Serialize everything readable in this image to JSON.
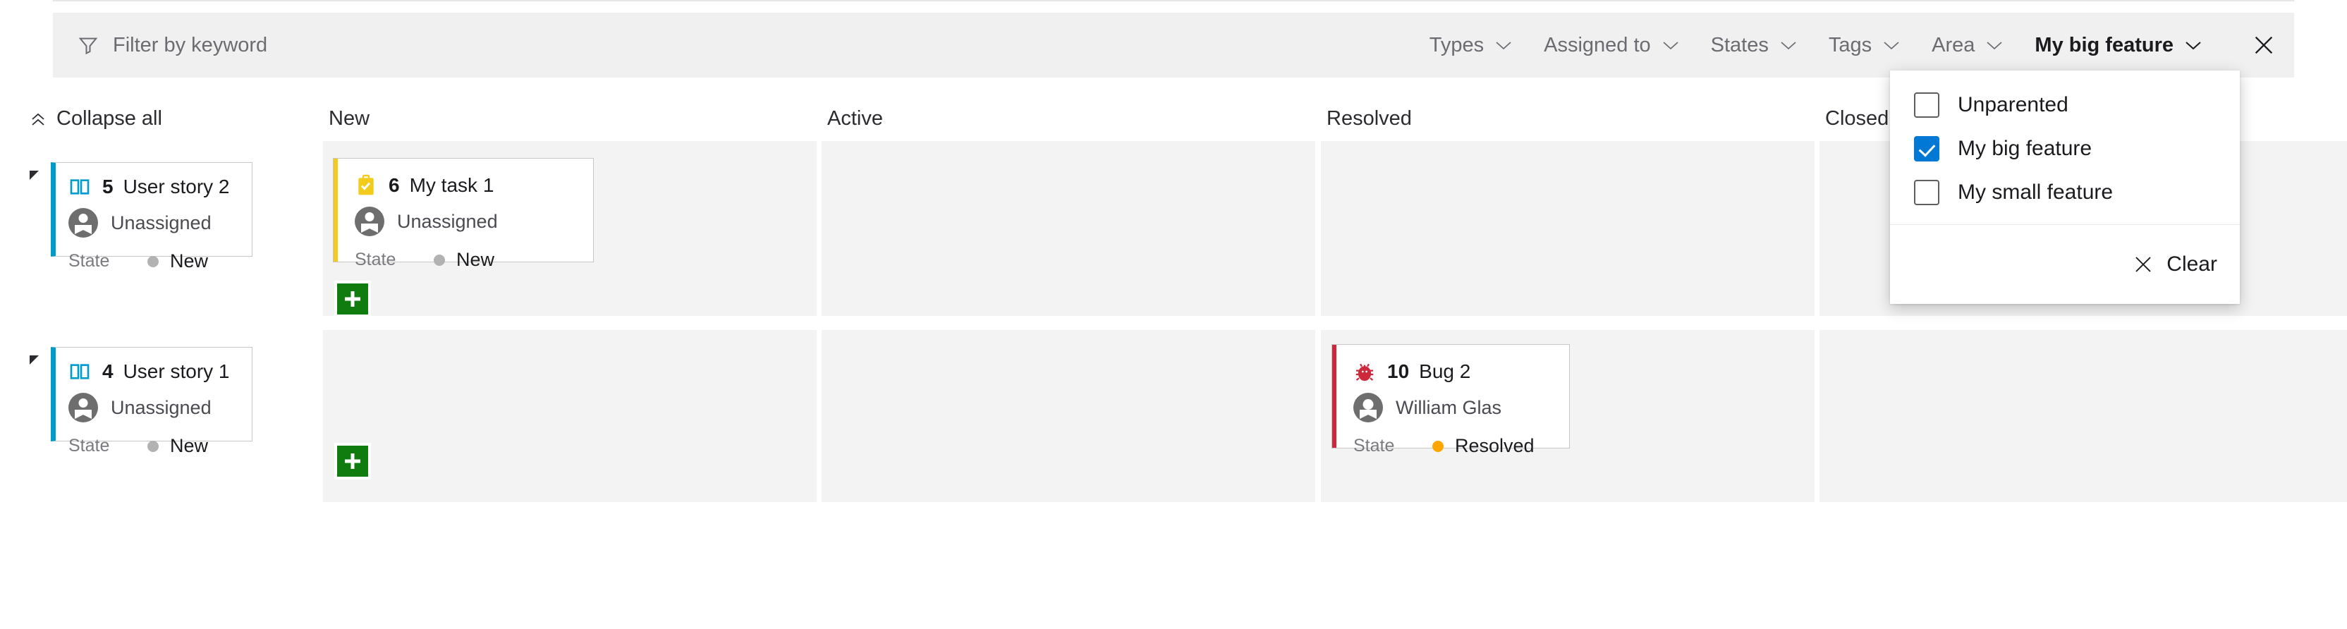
{
  "filter_bar": {
    "funnel_icon": "funnel-icon",
    "keyword": {
      "value": "",
      "placeholder": "Filter by keyword"
    },
    "pivots": [
      {
        "label": "Types",
        "active": false
      },
      {
        "label": "Assigned to",
        "active": false
      },
      {
        "label": "States",
        "active": false
      },
      {
        "label": "Tags",
        "active": false
      },
      {
        "label": "Area",
        "active": false
      },
      {
        "label": "My big feature",
        "active": true
      }
    ],
    "close_icon": "close-icon"
  },
  "dropdown": {
    "open": true,
    "options": [
      {
        "label": "Unparented",
        "checked": false
      },
      {
        "label": "My big feature",
        "checked": true
      },
      {
        "label": "My small feature",
        "checked": false
      }
    ],
    "clear": {
      "label": "Clear",
      "icon": "close-icon"
    }
  },
  "board": {
    "collapse_all": {
      "label": "Collapse all",
      "icon": "double-chevron-up-icon"
    },
    "columns": [
      {
        "label": "New"
      },
      {
        "label": "Active"
      },
      {
        "label": "Resolved"
      },
      {
        "label": "Closed"
      }
    ],
    "colors": {
      "accent_blue": "#0078d4",
      "user_story": "#009ccc",
      "task": "#f2cb1d",
      "bug": "#cc293d",
      "add_button": "#107c10",
      "state_new": "#b2b2b2",
      "state_resolved": "#ffa500",
      "lane_bg": "#f3f3f3"
    },
    "lanes": [
      {
        "parent": {
          "id": "5",
          "title": "User story 2",
          "icon": "book-icon",
          "assignee": "Unassigned",
          "state_label": "State",
          "state_value": "New",
          "collapse_toggle": "lane-collapse-toggle"
        },
        "cells": [
          {
            "column": "New",
            "cards": [
              {
                "id": "6",
                "title": "My task 1",
                "icon": "task-checklist-icon",
                "assignee": "Unassigned",
                "state_label": "State",
                "state_value": "New"
              }
            ],
            "add_button": "add-card-button"
          },
          {
            "column": "Active",
            "cards": []
          },
          {
            "column": "Resolved",
            "cards": []
          },
          {
            "column": "Closed",
            "cards": []
          }
        ]
      },
      {
        "parent": {
          "id": "4",
          "title": "User story 1",
          "icon": "book-icon",
          "assignee": "Unassigned",
          "state_label": "State",
          "state_value": "New",
          "collapse_toggle": "lane-collapse-toggle"
        },
        "cells": [
          {
            "column": "New",
            "cards": [],
            "add_button": "add-card-button"
          },
          {
            "column": "Active",
            "cards": []
          },
          {
            "column": "Resolved",
            "cards": [
              {
                "id": "10",
                "title": "Bug 2",
                "icon": "bug-icon",
                "assignee": "William Glas",
                "state_label": "State",
                "state_value": "Resolved"
              }
            ]
          },
          {
            "column": "Closed",
            "cards": []
          }
        ]
      }
    ]
  }
}
